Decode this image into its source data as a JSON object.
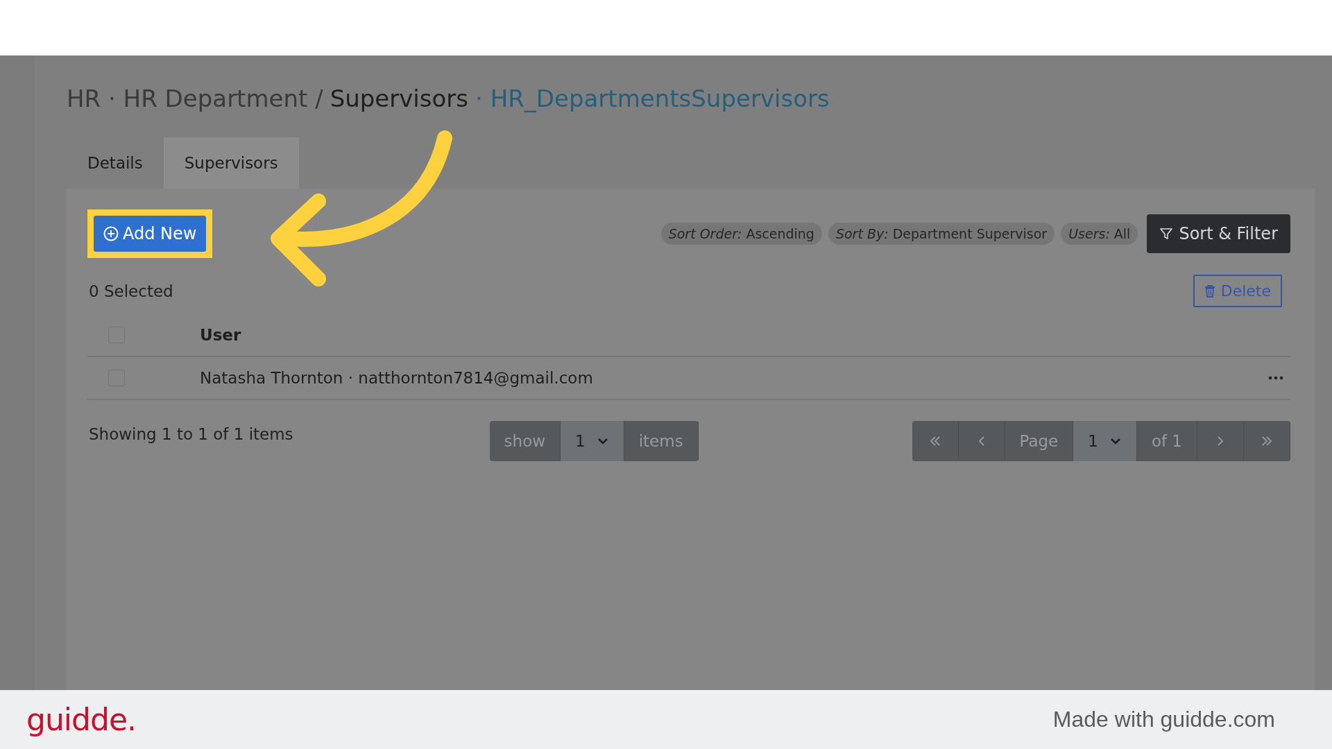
{
  "breadcrumb": {
    "prefix": "HR · HR Department /",
    "current": "Supervisors",
    "table_name": "· HR_DepartmentsSupervisors"
  },
  "tabs": [
    {
      "label": "Details",
      "selected": false
    },
    {
      "label": "Supervisors",
      "selected": true
    }
  ],
  "add_button": {
    "label": "Add New",
    "highlighted": true
  },
  "filter_chips": [
    {
      "name": "Sort Order:",
      "value": "Ascending"
    },
    {
      "name": "Sort By:",
      "value": "Department Supervisor"
    },
    {
      "name": "Users:",
      "value": "All"
    }
  ],
  "sort_filter_button": "Sort & Filter",
  "selected_count": "0 Selected",
  "delete_button": "Delete",
  "table": {
    "header": {
      "checked": false,
      "column": "User"
    },
    "rows": [
      {
        "checked": false,
        "user": "Natasha Thornton · natthornton7814@gmail.com"
      }
    ]
  },
  "showing": "Showing 1 to 1 of 1 items",
  "page_size": {
    "show": "show",
    "value": "1",
    "items": "items"
  },
  "pager": {
    "page": "Page",
    "value": "1",
    "of": "of 1"
  },
  "footer": {
    "logo": "guidde.",
    "credit": "Made with guidde.com"
  }
}
